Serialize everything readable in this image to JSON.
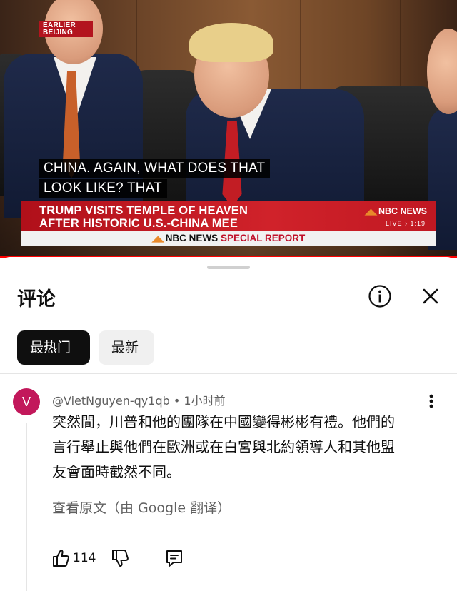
{
  "video": {
    "badge_line1": "EARLIER",
    "badge_line2": "BEIJING",
    "caption_line1": "CHINA. AGAIN, WHAT DOES THAT",
    "caption_line2": "LOOK LIKE? THAT",
    "headline_line1": "TRUMP VISITS TEMPLE OF HEAVEN",
    "headline_line2": "AFTER HISTORIC U.S.-CHINA MEE",
    "network_logo": "NBC NEWS",
    "live_label": "LIVE › 1:19",
    "footer_network": "NBC NEWS",
    "footer_special": "SPECIAL REPORT",
    "progress_fraction": 1.0
  },
  "comments_sheet": {
    "title": "评论",
    "info_icon": "info-circle-icon",
    "close_icon": "close-icon",
    "sort_chips": [
      {
        "label": "最热门",
        "active": true
      },
      {
        "label": "最新",
        "active": false
      }
    ]
  },
  "comment": {
    "avatar_letter": "V",
    "avatar_color": "#c2185b",
    "author": "@VietNguyen-qy1qb",
    "time": "1小时前",
    "body_line1": "突然間，川普和他的團隊在中國變得彬彬有禮。他們的",
    "body_line2": "言行舉止與他們在歐洲或在白宮與北約領導人和其他盟",
    "body_line3": "友會面時截然不同。",
    "translate_label": "查看原文（由 Google 翻译）",
    "like_count": "114",
    "icons": [
      "thumbs-up-icon",
      "thumbs-down-icon",
      "reply-icon",
      "more-vert-icon"
    ]
  }
}
